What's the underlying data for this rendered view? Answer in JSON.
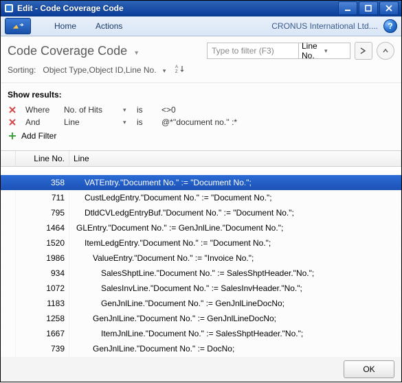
{
  "titlebar": {
    "title": "Edit - Code Coverage Code"
  },
  "ribbon": {
    "tabs": [
      "Home",
      "Actions"
    ],
    "company": "CRONUS International Ltd...."
  },
  "page": {
    "title": "Code Coverage Code",
    "sort_label": "Sorting:",
    "sort_value": "Object Type,Object ID,Line No."
  },
  "filter": {
    "placeholder": "Type to filter (F3)",
    "column_label": "Line No."
  },
  "show": {
    "heading": "Show results:",
    "rows": [
      {
        "kw": "Where",
        "field": "No. of Hits",
        "op": "is",
        "val": "<>0"
      },
      {
        "kw": "And",
        "field": "Line",
        "op": "is",
        "val": "@*''document no.'' :*"
      }
    ],
    "add_label": "Add Filter"
  },
  "grid": {
    "columns": [
      "Line No.",
      "Line"
    ],
    "rows": [
      {
        "ln": 358,
        "indent": 1,
        "selected": true,
        "line": "VATEntry.\"Document No.\" := \"Document No.\";"
      },
      {
        "ln": 711,
        "indent": 1,
        "selected": false,
        "line": "CustLedgEntry.\"Document No.\" := \"Document No.\";"
      },
      {
        "ln": 795,
        "indent": 1,
        "selected": false,
        "line": "DtldCVLedgEntryBuf.\"Document No.\" := \"Document No.\";"
      },
      {
        "ln": 1464,
        "indent": 0,
        "selected": false,
        "line": "GLEntry.\"Document No.\" := GenJnlLine.\"Document No.\";"
      },
      {
        "ln": 1520,
        "indent": 1,
        "selected": false,
        "line": "ItemLedgEntry.\"Document No.\" := \"Document No.\";"
      },
      {
        "ln": 1986,
        "indent": 2,
        "selected": false,
        "line": "ValueEntry.\"Document No.\" := \"Invoice No.\";"
      },
      {
        "ln": 934,
        "indent": 3,
        "selected": false,
        "line": "SalesShptLine.\"Document No.\" := SalesShptHeader.\"No.\";"
      },
      {
        "ln": 1072,
        "indent": 3,
        "selected": false,
        "line": "SalesInvLine.\"Document No.\" := SalesInvHeader.\"No.\";"
      },
      {
        "ln": 1183,
        "indent": 3,
        "selected": false,
        "line": "GenJnlLine.\"Document No.\" := GenJnlLineDocNo;"
      },
      {
        "ln": 1258,
        "indent": 2,
        "selected": false,
        "line": "GenJnlLine.\"Document No.\" := GenJnlLineDocNo;"
      },
      {
        "ln": 1667,
        "indent": 3,
        "selected": false,
        "line": "ItemJnlLine.\"Document No.\" := SalesShptHeader.\"No.\";"
      },
      {
        "ln": 739,
        "indent": 2,
        "selected": false,
        "line": "GenJnlLine.\"Document No.\" := DocNo;"
      }
    ]
  },
  "footer": {
    "ok": "OK"
  }
}
